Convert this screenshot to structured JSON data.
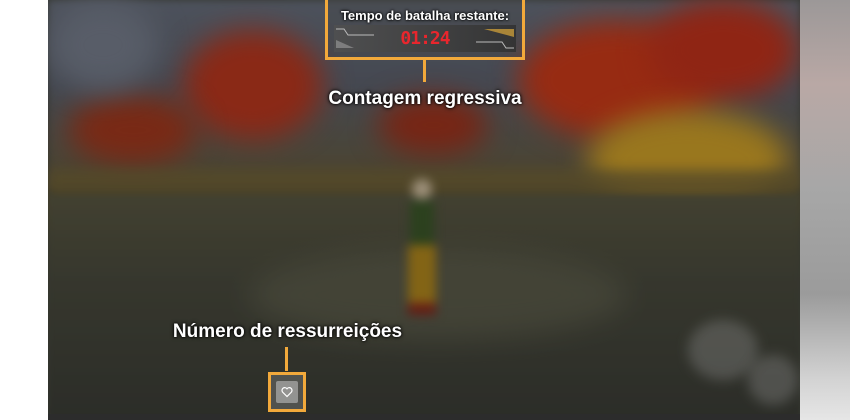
{
  "hud": {
    "timer_title": "Tempo de batalha restante:",
    "timer_value": "01:24"
  },
  "annotations": {
    "countdown_label": "Contagem regressiva",
    "revives_label": "Número de ressurreições"
  },
  "icons": {
    "revive": "heart-icon"
  },
  "colors": {
    "highlight": "#f2a93b",
    "timer_digits": "#e8262d"
  }
}
